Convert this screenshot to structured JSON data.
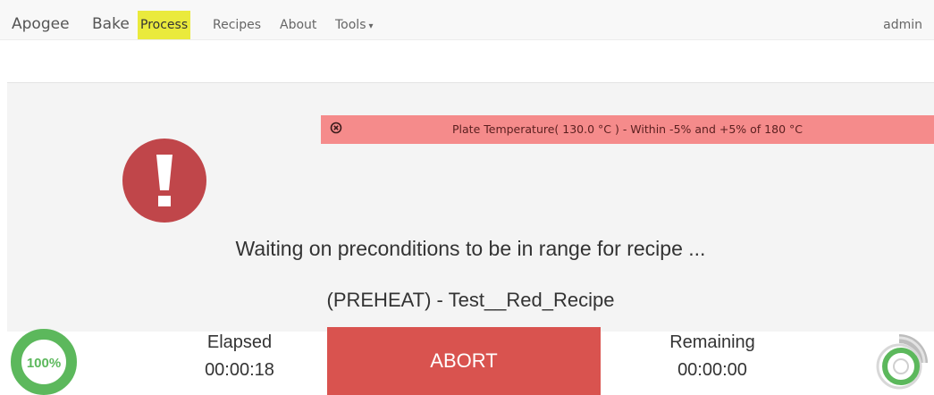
{
  "nav": {
    "brand_1": "Apogee",
    "brand_2": "Bake",
    "items": [
      {
        "label": "Process",
        "active": true
      },
      {
        "label": "Recipes",
        "active": false
      },
      {
        "label": "About",
        "active": false
      },
      {
        "label": "Tools",
        "active": false,
        "dropdown": true
      }
    ],
    "user": "admin",
    "active_color": "#eaea3c"
  },
  "alert": {
    "icon": "circle-x-icon",
    "text": "Plate Temperature( 130.0 °C ) - Within -5% and +5% of 180 °C",
    "color": "#f58b8b"
  },
  "status": {
    "icon": "exclamation-circle-icon",
    "icon_color": "#c0464a",
    "message": "Waiting on preconditions to be in range for recipe ...",
    "recipe": "(PREHEAT) - Test__Red_Recipe"
  },
  "progress": {
    "label": "100%",
    "fraction": 1.0,
    "color": "#5cb85c"
  },
  "elapsed": {
    "label": "Elapsed",
    "value": "00:00:18"
  },
  "abort": {
    "label": "ABORT",
    "color": "#d9534f"
  },
  "remaining": {
    "label": "Remaining",
    "value": "00:00:00"
  },
  "remaining_gauge": {
    "icon": "circular-gauge-icon",
    "color": "#5cb85c",
    "track_color": "#cccccc"
  }
}
